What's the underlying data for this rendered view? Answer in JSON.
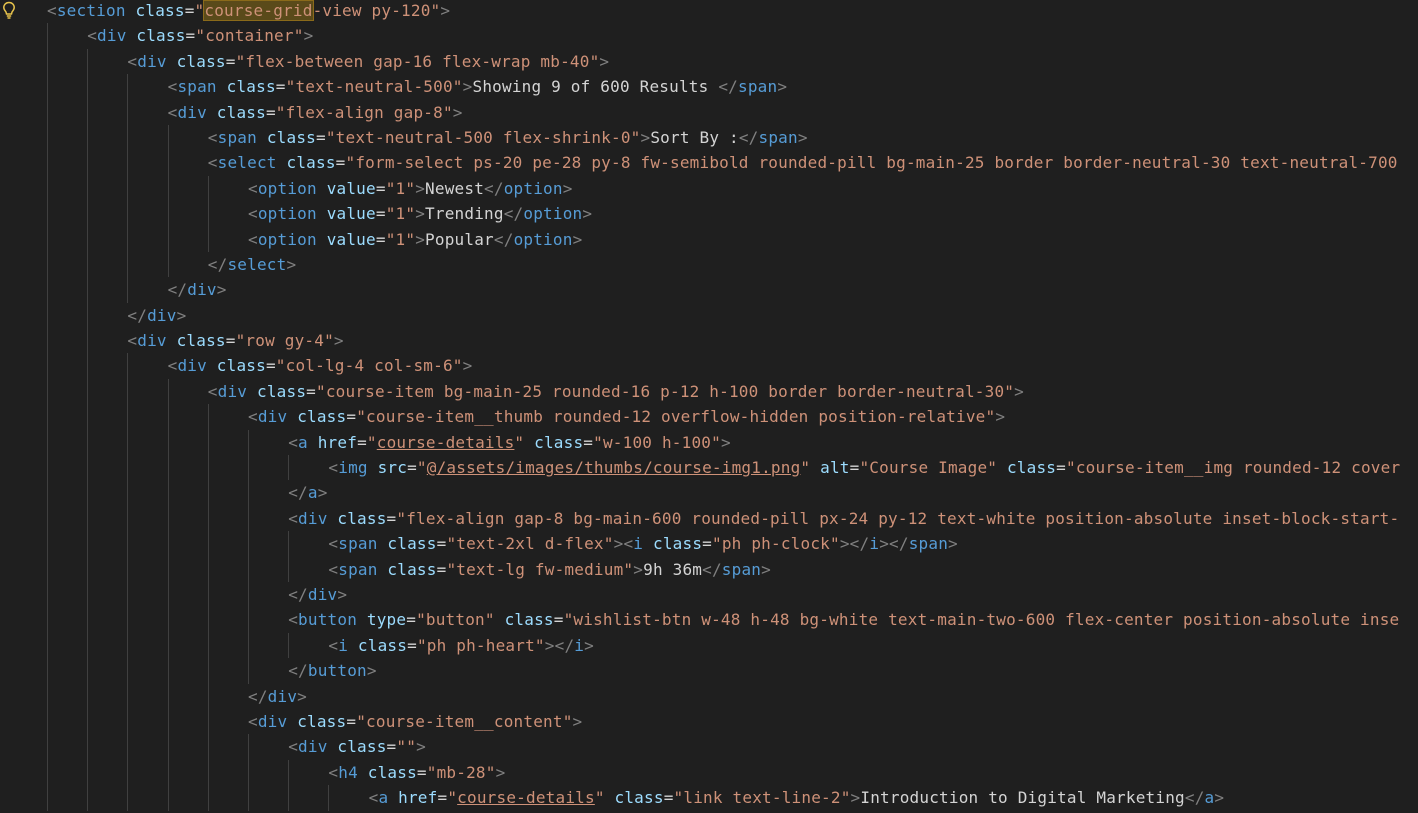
{
  "colors": {
    "background": "#1f1f1f",
    "tag": "#569cd6",
    "attribute": "#9cdcfe",
    "string": "#ce9178",
    "text": "#d4d4d4",
    "bracket": "#808080",
    "lightbulb": "#e8c44c"
  },
  "icons": {
    "lightbulb": "lightbulb-icon"
  },
  "lines": [
    {
      "indent": 0,
      "tokens": [
        [
          "b",
          "<"
        ],
        [
          "t",
          "section"
        ],
        [
          "x",
          " "
        ],
        [
          "a",
          "class"
        ],
        [
          "x",
          "="
        ],
        [
          "s",
          "\""
        ],
        [
          "sh",
          "course-grid"
        ],
        [
          "s",
          "-view py-120\""
        ],
        [
          "b",
          ">"
        ]
      ]
    },
    {
      "indent": 1,
      "tokens": [
        [
          "b",
          "<"
        ],
        [
          "t",
          "div"
        ],
        [
          "x",
          " "
        ],
        [
          "a",
          "class"
        ],
        [
          "x",
          "="
        ],
        [
          "s",
          "\"container\""
        ],
        [
          "b",
          ">"
        ]
      ]
    },
    {
      "indent": 2,
      "tokens": [
        [
          "b",
          "<"
        ],
        [
          "t",
          "div"
        ],
        [
          "x",
          " "
        ],
        [
          "a",
          "class"
        ],
        [
          "x",
          "="
        ],
        [
          "s",
          "\"flex-between gap-16 flex-wrap mb-40\""
        ],
        [
          "b",
          ">"
        ]
      ]
    },
    {
      "indent": 3,
      "tokens": [
        [
          "b",
          "<"
        ],
        [
          "t",
          "span"
        ],
        [
          "x",
          " "
        ],
        [
          "a",
          "class"
        ],
        [
          "x",
          "="
        ],
        [
          "s",
          "\"text-neutral-500\""
        ],
        [
          "b",
          ">"
        ],
        [
          "x",
          "Showing 9 of 600 Results "
        ],
        [
          "b",
          "</"
        ],
        [
          "t",
          "span"
        ],
        [
          "b",
          ">"
        ]
      ]
    },
    {
      "indent": 3,
      "tokens": [
        [
          "b",
          "<"
        ],
        [
          "t",
          "div"
        ],
        [
          "x",
          " "
        ],
        [
          "a",
          "class"
        ],
        [
          "x",
          "="
        ],
        [
          "s",
          "\"flex-align gap-8\""
        ],
        [
          "b",
          ">"
        ]
      ]
    },
    {
      "indent": 4,
      "tokens": [
        [
          "b",
          "<"
        ],
        [
          "t",
          "span"
        ],
        [
          "x",
          " "
        ],
        [
          "a",
          "class"
        ],
        [
          "x",
          "="
        ],
        [
          "s",
          "\"text-neutral-500 flex-shrink-0\""
        ],
        [
          "b",
          ">"
        ],
        [
          "x",
          "Sort By :"
        ],
        [
          "b",
          "</"
        ],
        [
          "t",
          "span"
        ],
        [
          "b",
          ">"
        ]
      ]
    },
    {
      "indent": 4,
      "tokens": [
        [
          "b",
          "<"
        ],
        [
          "t",
          "select"
        ],
        [
          "x",
          " "
        ],
        [
          "a",
          "class"
        ],
        [
          "x",
          "="
        ],
        [
          "s",
          "\"form-select ps-20 pe-28 py-8 fw-semibold rounded-pill bg-main-25 border border-neutral-30 text-neutral-700"
        ]
      ]
    },
    {
      "indent": 5,
      "tokens": [
        [
          "b",
          "<"
        ],
        [
          "t",
          "option"
        ],
        [
          "x",
          " "
        ],
        [
          "a",
          "value"
        ],
        [
          "x",
          "="
        ],
        [
          "s",
          "\"1\""
        ],
        [
          "b",
          ">"
        ],
        [
          "x",
          "Newest"
        ],
        [
          "b",
          "</"
        ],
        [
          "t",
          "option"
        ],
        [
          "b",
          ">"
        ]
      ]
    },
    {
      "indent": 5,
      "tokens": [
        [
          "b",
          "<"
        ],
        [
          "t",
          "option"
        ],
        [
          "x",
          " "
        ],
        [
          "a",
          "value"
        ],
        [
          "x",
          "="
        ],
        [
          "s",
          "\"1\""
        ],
        [
          "b",
          ">"
        ],
        [
          "x",
          "Trending"
        ],
        [
          "b",
          "</"
        ],
        [
          "t",
          "option"
        ],
        [
          "b",
          ">"
        ]
      ]
    },
    {
      "indent": 5,
      "tokens": [
        [
          "b",
          "<"
        ],
        [
          "t",
          "option"
        ],
        [
          "x",
          " "
        ],
        [
          "a",
          "value"
        ],
        [
          "x",
          "="
        ],
        [
          "s",
          "\"1\""
        ],
        [
          "b",
          ">"
        ],
        [
          "x",
          "Popular"
        ],
        [
          "b",
          "</"
        ],
        [
          "t",
          "option"
        ],
        [
          "b",
          ">"
        ]
      ]
    },
    {
      "indent": 4,
      "tokens": [
        [
          "b",
          "</"
        ],
        [
          "t",
          "select"
        ],
        [
          "b",
          ">"
        ]
      ]
    },
    {
      "indent": 3,
      "tokens": [
        [
          "b",
          "</"
        ],
        [
          "t",
          "div"
        ],
        [
          "b",
          ">"
        ]
      ]
    },
    {
      "indent": 2,
      "tokens": [
        [
          "b",
          "</"
        ],
        [
          "t",
          "div"
        ],
        [
          "b",
          ">"
        ]
      ]
    },
    {
      "indent": 2,
      "tokens": [
        [
          "b",
          "<"
        ],
        [
          "t",
          "div"
        ],
        [
          "x",
          " "
        ],
        [
          "a",
          "class"
        ],
        [
          "x",
          "="
        ],
        [
          "s",
          "\"row gy-4\""
        ],
        [
          "b",
          ">"
        ]
      ]
    },
    {
      "indent": 3,
      "tokens": [
        [
          "b",
          "<"
        ],
        [
          "t",
          "div"
        ],
        [
          "x",
          " "
        ],
        [
          "a",
          "class"
        ],
        [
          "x",
          "="
        ],
        [
          "s",
          "\"col-lg-4 col-sm-6\""
        ],
        [
          "b",
          ">"
        ]
      ]
    },
    {
      "indent": 4,
      "tokens": [
        [
          "b",
          "<"
        ],
        [
          "t",
          "div"
        ],
        [
          "x",
          " "
        ],
        [
          "a",
          "class"
        ],
        [
          "x",
          "="
        ],
        [
          "s",
          "\"course-item bg-main-25 rounded-16 p-12 h-100 border border-neutral-30\""
        ],
        [
          "b",
          ">"
        ]
      ]
    },
    {
      "indent": 5,
      "tokens": [
        [
          "b",
          "<"
        ],
        [
          "t",
          "div"
        ],
        [
          "x",
          " "
        ],
        [
          "a",
          "class"
        ],
        [
          "x",
          "="
        ],
        [
          "s",
          "\"course-item__thumb rounded-12 overflow-hidden position-relative\""
        ],
        [
          "b",
          ">"
        ]
      ]
    },
    {
      "indent": 6,
      "tokens": [
        [
          "b",
          "<"
        ],
        [
          "t",
          "a"
        ],
        [
          "x",
          " "
        ],
        [
          "a",
          "href"
        ],
        [
          "x",
          "="
        ],
        [
          "s",
          "\""
        ],
        [
          "su",
          "course-details"
        ],
        [
          "s",
          "\""
        ],
        [
          "x",
          " "
        ],
        [
          "a",
          "class"
        ],
        [
          "x",
          "="
        ],
        [
          "s",
          "\"w-100 h-100\""
        ],
        [
          "b",
          ">"
        ]
      ]
    },
    {
      "indent": 7,
      "tokens": [
        [
          "b",
          "<"
        ],
        [
          "t",
          "img"
        ],
        [
          "x",
          " "
        ],
        [
          "a",
          "src"
        ],
        [
          "x",
          "="
        ],
        [
          "s",
          "\""
        ],
        [
          "su",
          "@/assets/images/thumbs/course-img1.png"
        ],
        [
          "s",
          "\""
        ],
        [
          "x",
          " "
        ],
        [
          "a",
          "alt"
        ],
        [
          "x",
          "="
        ],
        [
          "s",
          "\"Course Image\""
        ],
        [
          "x",
          " "
        ],
        [
          "a",
          "class"
        ],
        [
          "x",
          "="
        ],
        [
          "s",
          "\"course-item__img rounded-12 cover"
        ]
      ]
    },
    {
      "indent": 6,
      "tokens": [
        [
          "b",
          "</"
        ],
        [
          "t",
          "a"
        ],
        [
          "b",
          ">"
        ]
      ]
    },
    {
      "indent": 6,
      "tokens": [
        [
          "b",
          "<"
        ],
        [
          "t",
          "div"
        ],
        [
          "x",
          " "
        ],
        [
          "a",
          "class"
        ],
        [
          "x",
          "="
        ],
        [
          "s",
          "\"flex-align gap-8 bg-main-600 rounded-pill px-24 py-12 text-white position-absolute inset-block-start-"
        ]
      ]
    },
    {
      "indent": 7,
      "tokens": [
        [
          "b",
          "<"
        ],
        [
          "t",
          "span"
        ],
        [
          "x",
          " "
        ],
        [
          "a",
          "class"
        ],
        [
          "x",
          "="
        ],
        [
          "s",
          "\"text-2xl d-flex\""
        ],
        [
          "b",
          ">"
        ],
        [
          "b",
          "<"
        ],
        [
          "t",
          "i"
        ],
        [
          "x",
          " "
        ],
        [
          "a",
          "class"
        ],
        [
          "x",
          "="
        ],
        [
          "s",
          "\"ph ph-clock\""
        ],
        [
          "b",
          ">"
        ],
        [
          "b",
          "</"
        ],
        [
          "t",
          "i"
        ],
        [
          "b",
          ">"
        ],
        [
          "b",
          "</"
        ],
        [
          "t",
          "span"
        ],
        [
          "b",
          ">"
        ]
      ]
    },
    {
      "indent": 7,
      "tokens": [
        [
          "b",
          "<"
        ],
        [
          "t",
          "span"
        ],
        [
          "x",
          " "
        ],
        [
          "a",
          "class"
        ],
        [
          "x",
          "="
        ],
        [
          "s",
          "\"text-lg fw-medium\""
        ],
        [
          "b",
          ">"
        ],
        [
          "x",
          "9h 36m"
        ],
        [
          "b",
          "</"
        ],
        [
          "t",
          "span"
        ],
        [
          "b",
          ">"
        ]
      ]
    },
    {
      "indent": 6,
      "tokens": [
        [
          "b",
          "</"
        ],
        [
          "t",
          "div"
        ],
        [
          "b",
          ">"
        ]
      ]
    },
    {
      "indent": 6,
      "tokens": [
        [
          "b",
          "<"
        ],
        [
          "t",
          "button"
        ],
        [
          "x",
          " "
        ],
        [
          "a",
          "type"
        ],
        [
          "x",
          "="
        ],
        [
          "s",
          "\"button\""
        ],
        [
          "x",
          " "
        ],
        [
          "a",
          "class"
        ],
        [
          "x",
          "="
        ],
        [
          "s",
          "\"wishlist-btn w-48 h-48 bg-white text-main-two-600 flex-center position-absolute inse"
        ]
      ]
    },
    {
      "indent": 7,
      "tokens": [
        [
          "b",
          "<"
        ],
        [
          "t",
          "i"
        ],
        [
          "x",
          " "
        ],
        [
          "a",
          "class"
        ],
        [
          "x",
          "="
        ],
        [
          "s",
          "\"ph ph-heart\""
        ],
        [
          "b",
          ">"
        ],
        [
          "b",
          "</"
        ],
        [
          "t",
          "i"
        ],
        [
          "b",
          ">"
        ]
      ]
    },
    {
      "indent": 6,
      "tokens": [
        [
          "b",
          "</"
        ],
        [
          "t",
          "button"
        ],
        [
          "b",
          ">"
        ]
      ]
    },
    {
      "indent": 5,
      "tokens": [
        [
          "b",
          "</"
        ],
        [
          "t",
          "div"
        ],
        [
          "b",
          ">"
        ]
      ]
    },
    {
      "indent": 5,
      "tokens": [
        [
          "b",
          "<"
        ],
        [
          "t",
          "div"
        ],
        [
          "x",
          " "
        ],
        [
          "a",
          "class"
        ],
        [
          "x",
          "="
        ],
        [
          "s",
          "\"course-item__content\""
        ],
        [
          "b",
          ">"
        ]
      ]
    },
    {
      "indent": 6,
      "tokens": [
        [
          "b",
          "<"
        ],
        [
          "t",
          "div"
        ],
        [
          "x",
          " "
        ],
        [
          "a",
          "class"
        ],
        [
          "x",
          "="
        ],
        [
          "s",
          "\"\""
        ],
        [
          "b",
          ">"
        ]
      ]
    },
    {
      "indent": 7,
      "tokens": [
        [
          "b",
          "<"
        ],
        [
          "t",
          "h4"
        ],
        [
          "x",
          " "
        ],
        [
          "a",
          "class"
        ],
        [
          "x",
          "="
        ],
        [
          "s",
          "\"mb-28\""
        ],
        [
          "b",
          ">"
        ]
      ]
    },
    {
      "indent": 8,
      "tokens": [
        [
          "b",
          "<"
        ],
        [
          "t",
          "a"
        ],
        [
          "x",
          " "
        ],
        [
          "a",
          "href"
        ],
        [
          "x",
          "="
        ],
        [
          "s",
          "\""
        ],
        [
          "su",
          "course-details"
        ],
        [
          "s",
          "\""
        ],
        [
          "x",
          " "
        ],
        [
          "a",
          "class"
        ],
        [
          "x",
          "="
        ],
        [
          "s",
          "\"link text-line-2\""
        ],
        [
          "b",
          ">"
        ],
        [
          "x",
          "Introduction to Digital Marketing"
        ],
        [
          "b",
          "</"
        ],
        [
          "t",
          "a"
        ],
        [
          "b",
          ">"
        ]
      ]
    }
  ]
}
